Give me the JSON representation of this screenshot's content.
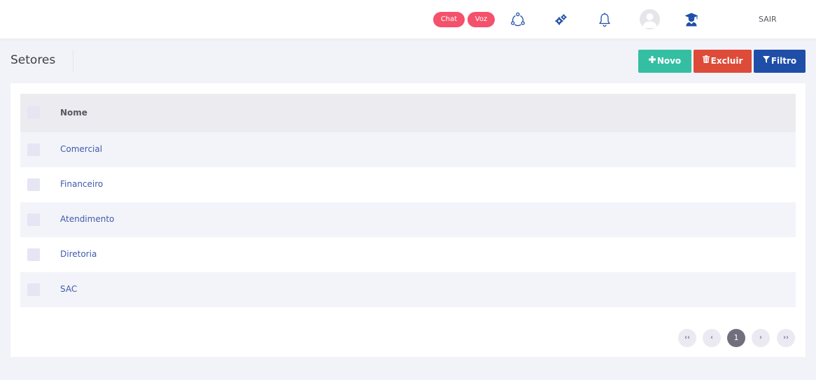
{
  "topbar": {
    "chat_label": "Chat",
    "voz_label": "Voz",
    "logout_label": "SAIR",
    "icons": [
      "network-icon",
      "gears-icon",
      "bell-icon",
      "user-avatar",
      "graduate-icon"
    ],
    "pill_color": "#f4516c",
    "icon_color": "#1f4ea8"
  },
  "page": {
    "title": "Setores"
  },
  "toolbar": {
    "novo_label": "Novo",
    "excluir_label": "Excluir",
    "filtro_label": "Filtro",
    "novo_color": "#34bfa3",
    "excluir_color": "#dd4b39",
    "filtro_color": "#1f4ea8"
  },
  "table": {
    "header": "Nome",
    "rows": [
      "Comercial",
      "Financeiro",
      "Atendimento",
      "Diretoria",
      "SAC"
    ]
  },
  "pagination": {
    "first": "‹‹",
    "prev": "‹",
    "current": "1",
    "next": "›",
    "last": "››"
  }
}
